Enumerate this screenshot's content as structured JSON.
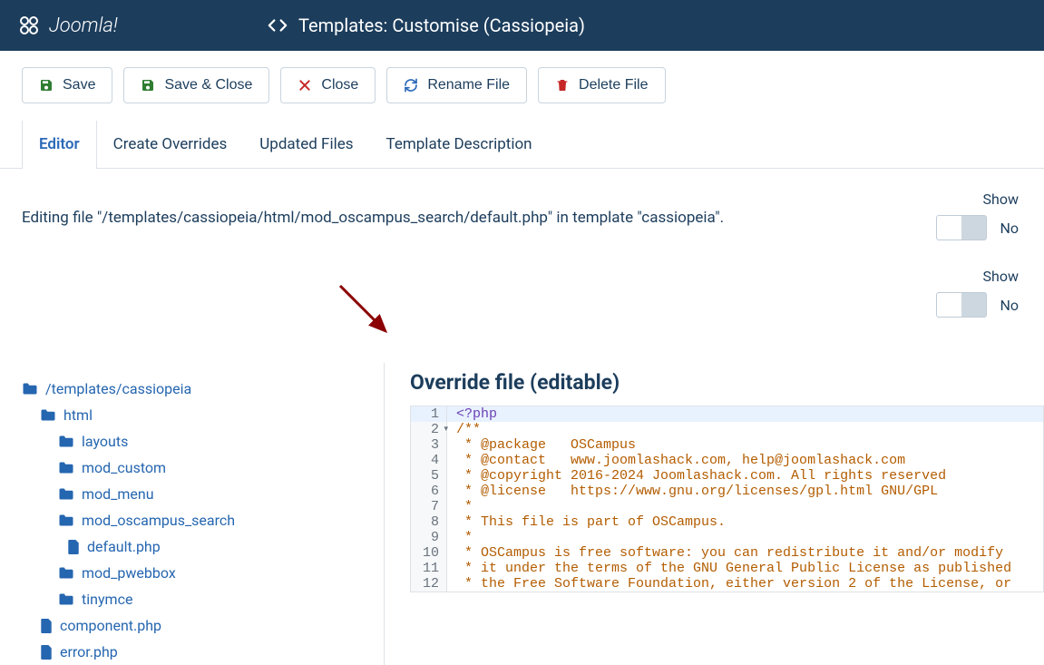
{
  "header": {
    "brand": "Joomla!",
    "page_title": "Templates: Customise (Cassiopeia)"
  },
  "toolbar": {
    "save": "Save",
    "save_close": "Save & Close",
    "close": "Close",
    "rename": "Rename File",
    "delete": "Delete File"
  },
  "tabs": {
    "editor": "Editor",
    "overrides": "Create Overrides",
    "updated": "Updated Files",
    "description": "Template Description"
  },
  "editing_text": "Editing file \"/templates/cassiopeia/html/mod_oscampus_search/default.php\" in template \"cassiopeia\".",
  "side": {
    "show1": "Show",
    "no1": "No",
    "show2": "Show",
    "no2": "No"
  },
  "tree": {
    "root": "/templates/cassiopeia",
    "html": "html",
    "layouts": "layouts",
    "mod_custom": "mod_custom",
    "mod_menu": "mod_menu",
    "mod_oscampus_search": "mod_oscampus_search",
    "default_php": "default.php",
    "mod_pwebbox": "mod_pwebbox",
    "tinymce": "tinymce",
    "component_php": "component.php",
    "error_php": "error.php"
  },
  "editor": {
    "title": "Override file (editable)",
    "lines": [
      "<?php",
      "/**",
      " * @package   OSCampus",
      " * @contact   www.joomlashack.com, help@joomlashack.com",
      " * @copyright 2016-2024 Joomlashack.com. All rights reserved",
      " * @license   https://www.gnu.org/licenses/gpl.html GNU/GPL",
      " *",
      " * This file is part of OSCampus.",
      " *",
      " * OSCampus is free software: you can redistribute it and/or modify",
      " * it under the terms of the GNU General Public License as published",
      " * the Free Software Foundation, either version 2 of the License, or"
    ]
  }
}
